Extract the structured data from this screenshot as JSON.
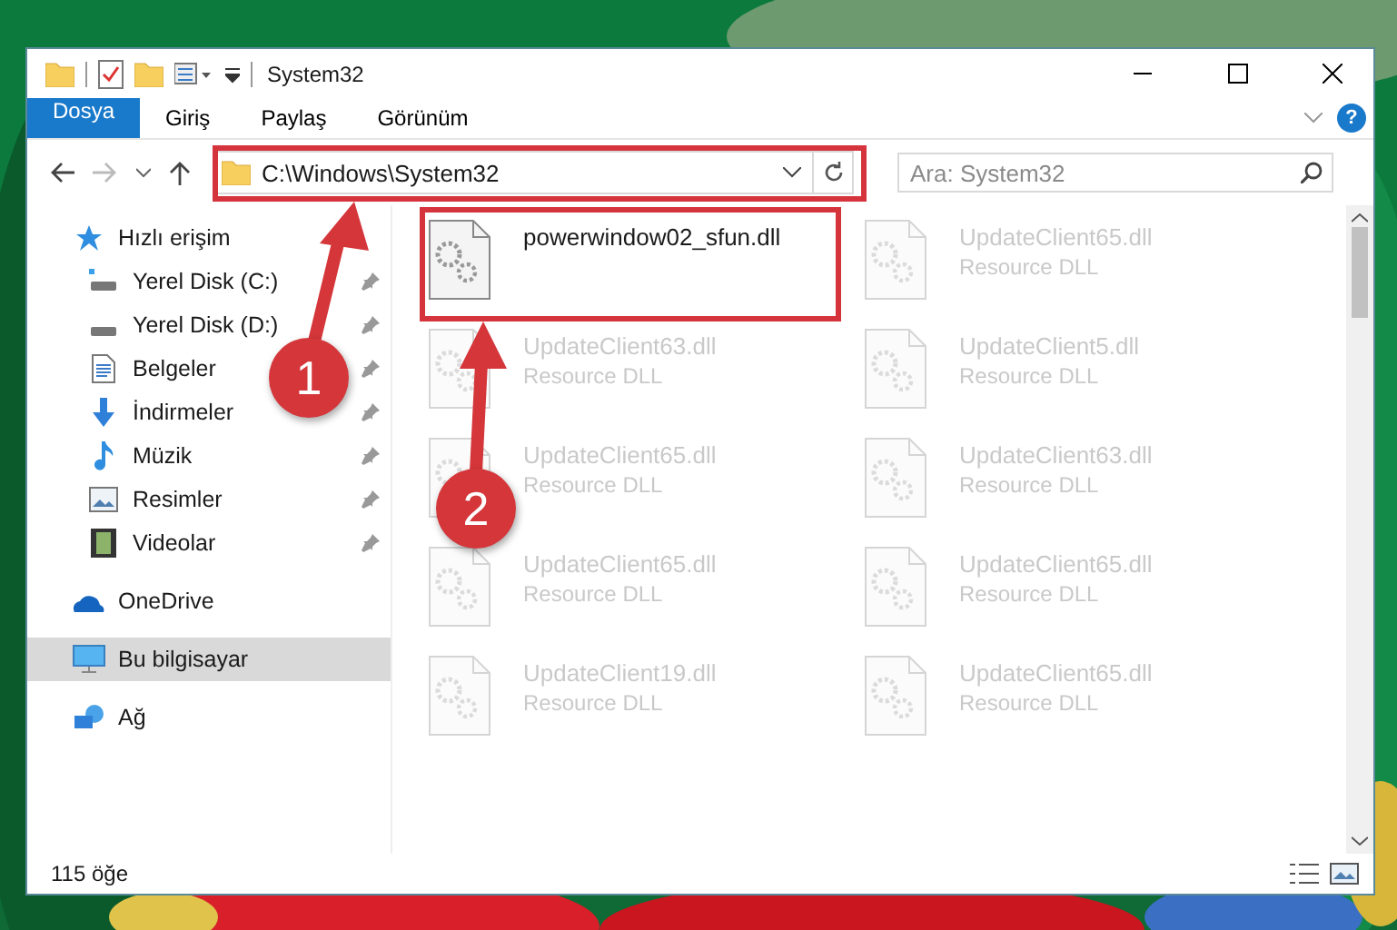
{
  "window": {
    "title": "System32"
  },
  "ribbon_tabs": [
    {
      "label": "Dosya",
      "kind": "file"
    },
    {
      "label": "Giriş",
      "kind": "tab"
    },
    {
      "label": "Paylaş",
      "kind": "tab"
    },
    {
      "label": "Görünüm",
      "kind": "tab"
    }
  ],
  "help": "?",
  "address": {
    "path": "C:\\Windows\\System32"
  },
  "search": {
    "placeholder": "Ara: System32"
  },
  "sidebar": {
    "items": [
      {
        "label": "Hızlı erişim",
        "selected": false,
        "children": [
          {
            "label": "Yerel Disk (C:)",
            "pinned": true
          },
          {
            "label": "Yerel Disk (D:)",
            "pinned": true
          },
          {
            "label": "Belgeler",
            "pinned": true
          },
          {
            "label": "İndirmeler",
            "pinned": true
          },
          {
            "label": "Müzik",
            "pinned": true
          },
          {
            "label": "Resimler",
            "pinned": true
          },
          {
            "label": "Videolar",
            "pinned": true
          }
        ]
      },
      {
        "label": "OneDrive",
        "selected": false
      },
      {
        "label": "Bu bilgisayar",
        "selected": true
      },
      {
        "label": "Ağ",
        "selected": false
      }
    ]
  },
  "files": [
    {
      "name": "powerwindow02_sfun.dll",
      "faded": false
    },
    {
      "name": "UpdateClient65.dll",
      "type": "Resource DLL",
      "faded": true
    },
    {
      "name": "UpdateClient63.dll",
      "type": "Resource DLL",
      "faded": true
    },
    {
      "name": "UpdateClient5.dll",
      "type": "Resource DLL",
      "faded": true
    },
    {
      "name": "UpdateClient65.dll",
      "type": "Resource DLL",
      "faded": true
    },
    {
      "name": "UpdateClient63.dll",
      "type": "Resource DLL",
      "faded": true
    },
    {
      "name": "UpdateClient65.dll",
      "type": "Resource DLL",
      "faded": true
    },
    {
      "name": "UpdateClient65.dll",
      "type": "Resource DLL",
      "faded": true
    },
    {
      "name": "UpdateClient19.dll",
      "type": "Resource DLL",
      "faded": true
    },
    {
      "name": "UpdateClient65.dll",
      "type": "Resource DLL",
      "faded": true
    }
  ],
  "status_bar": {
    "count": "115 öğe"
  },
  "annotations": [
    {
      "label": "1"
    },
    {
      "label": "2"
    }
  ]
}
